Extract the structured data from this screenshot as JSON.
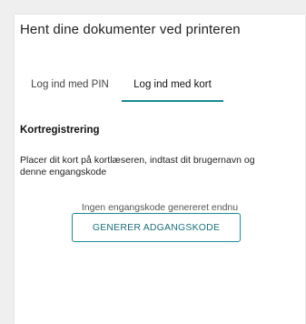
{
  "panel": {
    "title": "Hent dine dokumenter ved printeren"
  },
  "tabs": [
    {
      "label": "Log ind med PIN",
      "active": false
    },
    {
      "label": "Log ind med kort",
      "active": true
    }
  ],
  "card_registration": {
    "heading": "Kortregistrering",
    "description": "Placer dit kort på kortlæseren, indtast dit brugernavn og denne engangskode",
    "status": "Ingen engangskode genereret endnu",
    "button_label": "GENERER ADGANGSKODE"
  },
  "colors": {
    "accent": "#1b8a96",
    "background": "#efefef",
    "card": "#ffffff"
  }
}
